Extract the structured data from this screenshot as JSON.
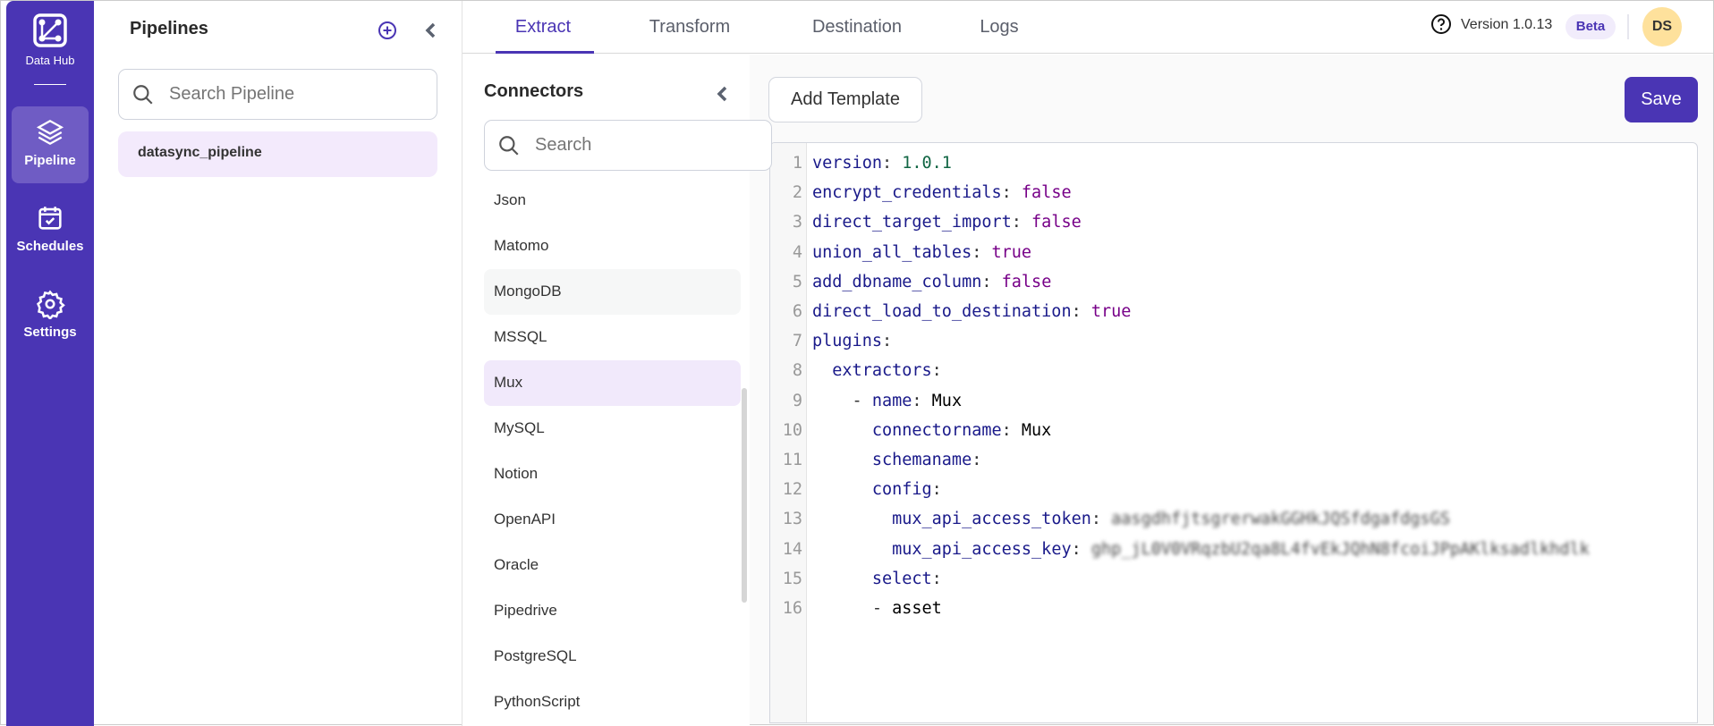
{
  "app": {
    "name": "Data Hub"
  },
  "rail": {
    "items": [
      {
        "label": "Pipeline",
        "icon": "layers-icon",
        "active": true
      },
      {
        "label": "Schedules",
        "icon": "calendar-check-icon"
      },
      {
        "label": "Settings",
        "icon": "gear-icon"
      }
    ]
  },
  "pipelines": {
    "title": "Pipelines",
    "search_placeholder": "Search Pipeline",
    "items": [
      "datasync_pipeline"
    ]
  },
  "tabs": [
    {
      "label": "Extract",
      "active": true
    },
    {
      "label": "Transform"
    },
    {
      "label": "Destination"
    },
    {
      "label": "Logs"
    }
  ],
  "header": {
    "version": "Version 1.0.13",
    "badge": "Beta",
    "avatar": "DS"
  },
  "connectors": {
    "title": "Connectors",
    "search_placeholder": "Search",
    "items": [
      "Json",
      "Matomo",
      "MongoDB",
      "MSSQL",
      "Mux",
      "MySQL",
      "Notion",
      "OpenAPI",
      "Oracle",
      "Pipedrive",
      "PostgreSQL",
      "PythonScript"
    ],
    "selected": "Mux",
    "hovered": "MongoDB"
  },
  "toolbar": {
    "add_template": "Add Template",
    "save": "Save"
  },
  "colors": {
    "accent": "#4a35b4",
    "selected_bg": "#f1e9fb",
    "avatar_bg": "#fee19c"
  },
  "editor": {
    "lines": [
      {
        "indent": "",
        "key": "version",
        "value": "1.0.1",
        "type": "n"
      },
      {
        "indent": "",
        "key": "encrypt_credentials",
        "value": "false",
        "type": "b"
      },
      {
        "indent": "",
        "key": "direct_target_import",
        "value": "false",
        "type": "b"
      },
      {
        "indent": "",
        "key": "union_all_tables",
        "value": "true",
        "type": "b"
      },
      {
        "indent": "",
        "key": "add_dbname_column",
        "value": "false",
        "type": "b"
      },
      {
        "indent": "",
        "key": "direct_load_to_destination",
        "value": "true",
        "type": "b"
      },
      {
        "indent": "",
        "key": "plugins",
        "value": "",
        "type": "s"
      },
      {
        "indent": "  ",
        "key": "extractors",
        "value": "",
        "type": "s"
      },
      {
        "indent": "    - ",
        "key": "name",
        "value": "Mux",
        "type": "s"
      },
      {
        "indent": "      ",
        "key": "connectorname",
        "value": "Mux",
        "type": "s"
      },
      {
        "indent": "      ",
        "key": "schemaname",
        "value": "",
        "type": "s"
      },
      {
        "indent": "      ",
        "key": "config",
        "value": "",
        "type": "s"
      },
      {
        "indent": "        ",
        "key": "mux_api_access_token",
        "value": "aasgdhfjtsgrerwakGGHkJQSfdgafdgsGS",
        "type": "blur"
      },
      {
        "indent": "        ",
        "key": "mux_api_access_key",
        "value": "ghp_jL0V0VRqzbU2qa8L4fvEkJQhN8fcoiJPpAKlksadlkhdlk",
        "type": "blur"
      },
      {
        "indent": "      ",
        "key": "select",
        "value": "",
        "type": "s"
      },
      {
        "indent": "      - ",
        "key": "",
        "value": "asset",
        "type": "s"
      }
    ]
  }
}
